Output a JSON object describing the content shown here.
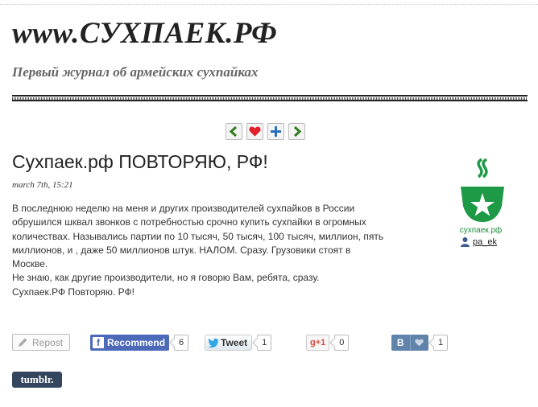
{
  "site": {
    "title": "www.СУХПАЕК.РФ",
    "subtitle": "Первый журнал об армейских сухпайках"
  },
  "nav": {
    "icons": [
      "left-arrow-icon",
      "heart-icon",
      "plus-icon",
      "right-arrow-icon"
    ]
  },
  "post": {
    "title": "Сухпаек.рф ПОВТОРЯЮ, РФ!",
    "date": "march 7th, 15:21",
    "lines": [
      "В последнюю неделю на меня и других производителей сухпайков в России",
      "обрушился шквал звонков с потребностью срочно купить сухпайки в огромных",
      "количествах. Назывались партии по 10 тысяч, 50 тысяч, 100 тысяч, миллион, пять",
      "миллионов, и , даже 50 миллионов штук. НАЛОМ. Сразу. Грузовики стоят в",
      "Москве.",
      "Не знаю, как другие производители, но я говорю Вам, ребята, сразу.",
      "Сухпаек.РФ  Повторяю. РФ!"
    ]
  },
  "author": {
    "logo_caption": "сухпаек.рф",
    "username": "pa_ek"
  },
  "share": {
    "repost": "Repost",
    "facebook": {
      "label": "Recommend",
      "count": "6"
    },
    "twitter": {
      "label": "Tweet",
      "count": "1"
    },
    "gplus": {
      "label": "g+1",
      "count": "0"
    },
    "vk": {
      "label": "В",
      "count": "1"
    },
    "tumblr": "tumblr."
  },
  "colors": {
    "green": "#1e9a47",
    "fb": "#4c69ba",
    "vk": "#5f83aa",
    "tumblr": "#34465d"
  }
}
